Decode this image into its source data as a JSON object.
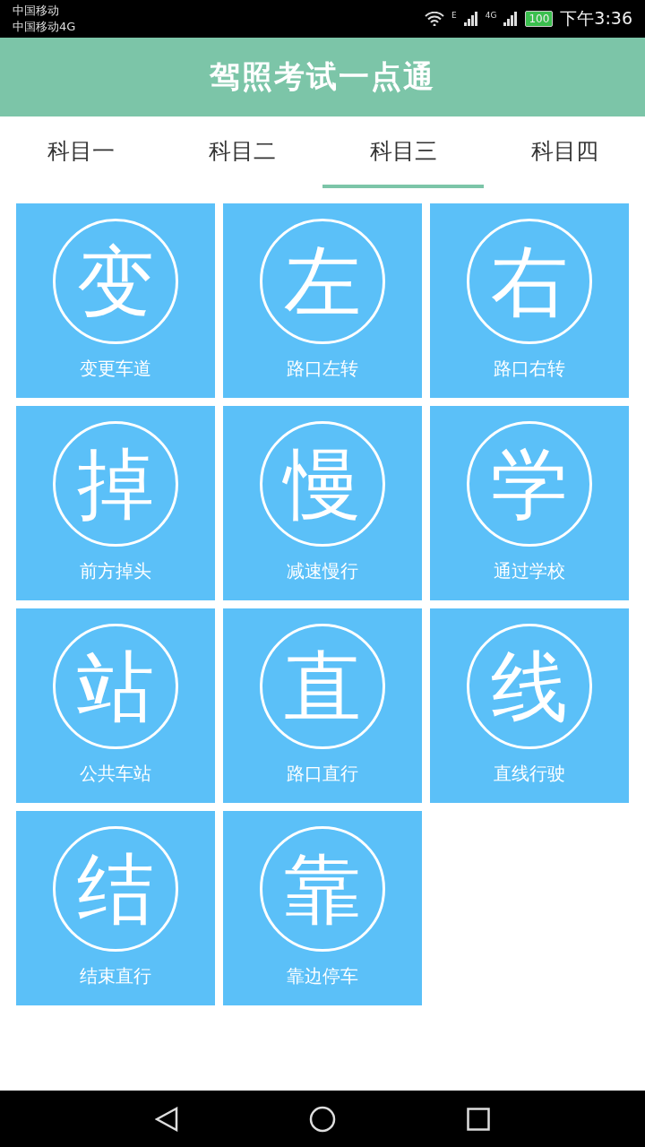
{
  "status_bar": {
    "carriers": [
      "中国移动",
      "中国移动4G"
    ],
    "network_labels": [
      "E",
      "4G"
    ],
    "battery": "100",
    "time": "下午3:36"
  },
  "header": {
    "title": "驾照考试一点通"
  },
  "tabs": [
    {
      "label": "科目一",
      "selected": false
    },
    {
      "label": "科目二",
      "selected": false
    },
    {
      "label": "科目三",
      "selected": true
    },
    {
      "label": "科目四",
      "selected": false
    }
  ],
  "tiles": [
    {
      "glyph": "变",
      "label": "变更车道"
    },
    {
      "glyph": "左",
      "label": "路口左转"
    },
    {
      "glyph": "右",
      "label": "路口右转"
    },
    {
      "glyph": "掉",
      "label": "前方掉头"
    },
    {
      "glyph": "慢",
      "label": "减速慢行"
    },
    {
      "glyph": "学",
      "label": "通过学校"
    },
    {
      "glyph": "站",
      "label": "公共车站"
    },
    {
      "glyph": "直",
      "label": "路口直行"
    },
    {
      "glyph": "线",
      "label": "直线行驶"
    },
    {
      "glyph": "结",
      "label": "结束直行"
    },
    {
      "glyph": "靠",
      "label": "靠边停车"
    }
  ]
}
